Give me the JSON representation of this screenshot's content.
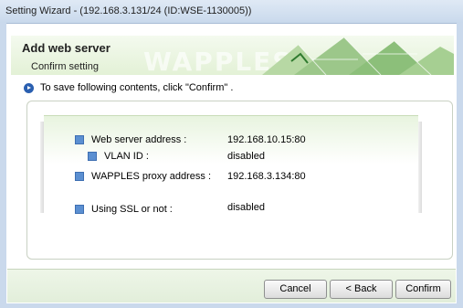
{
  "window": {
    "title": "Setting Wizard - (192.168.3.131/24 (ID:WSE-1130005))"
  },
  "header": {
    "title": "Add web server",
    "subtitle": "Confirm setting",
    "watermark": "WAPPLES"
  },
  "instruction": "To save following contents, click \"Confirm\" .",
  "settings": [
    {
      "label": "Web server address :",
      "value": "192.168.10.15:80"
    },
    {
      "label": "VLAN ID :",
      "value": "disabled"
    },
    {
      "label": "WAPPLES proxy address :",
      "value": "192.168.3.134:80"
    },
    {
      "label": "Using SSL or not :",
      "value": "disabled"
    }
  ],
  "buttons": {
    "cancel": "Cancel",
    "back": "< Back",
    "confirm": "Confirm"
  },
  "colors": {
    "header_bg": "#e3f1d6",
    "bullet": "#5b8fd1",
    "instruction_icon": "#2a5fb0"
  }
}
